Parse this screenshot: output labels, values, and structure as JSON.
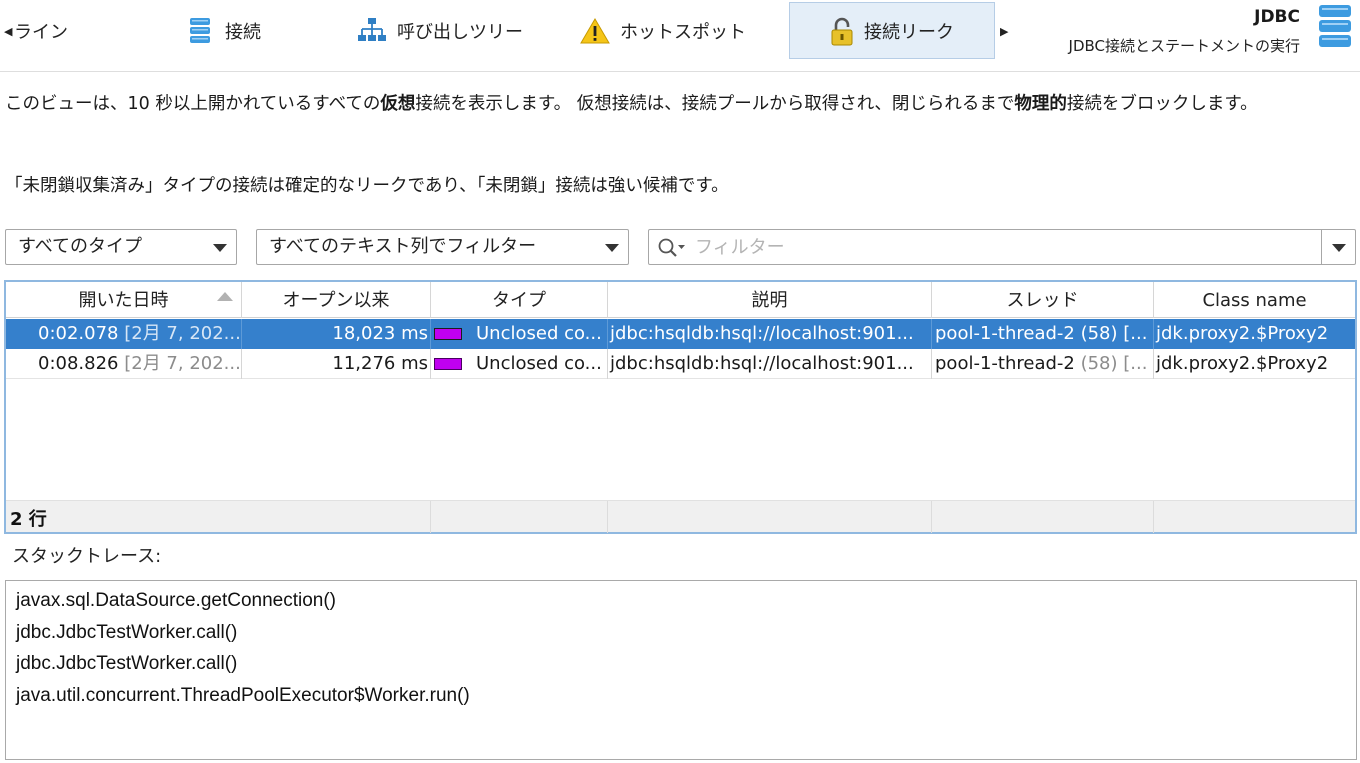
{
  "nav": {
    "tabs": [
      {
        "label": "ライン"
      },
      {
        "label": "接続"
      },
      {
        "label": "呼び出しツリー"
      },
      {
        "label": "ホットスポット"
      },
      {
        "label": "接続リーク"
      }
    ],
    "title": "JDBC",
    "subtitle": "JDBC接続とステートメントの実行"
  },
  "description": {
    "part1": "このビューは、10 秒以上開かれているすべての",
    "bold1": "仮想",
    "part2": "接続を表示します。 仮想接続は、接続プールから取得され、閉じられるまで",
    "bold2": "物理的",
    "part3": "接続をブロックします。",
    "note": "「未閉鎖収集済み」タイプの接続は確定的なリークであり、「未閉鎖」接続は強い候補です。"
  },
  "filters": {
    "type_filter": "すべてのタイプ",
    "column_filter": "すべてのテキスト列でフィルター",
    "search_placeholder": "フィルター"
  },
  "table": {
    "columns": [
      "開いた日時",
      "オープン以来",
      "タイプ",
      "説明",
      "スレッド",
      "Class name"
    ],
    "rows": [
      {
        "opened": "0:02.078",
        "opened_date": "[2月 7, 202...",
        "since": "18,023 ms",
        "type": "Unclosed co...",
        "description": "jdbc:hsqldb:hsql://localhost:901...",
        "thread": "pool-1-thread-2",
        "thread_id": "(58) [...",
        "class": "jdk.proxy2.$Proxy2"
      },
      {
        "opened": "0:08.826",
        "opened_date": "[2月 7, 202...",
        "since": "11,276 ms",
        "type": "Unclosed co...",
        "description": "jdbc:hsqldb:hsql://localhost:901...",
        "thread": "pool-1-thread-2",
        "thread_id": "(58) [...",
        "class": "jdk.proxy2.$Proxy2"
      }
    ],
    "row_count": "2 行"
  },
  "stack": {
    "label": "スタックトレース:",
    "frames": [
      "javax.sql.DataSource.getConnection()",
      "jdbc.JdbcTestWorker.call()",
      "jdbc.JdbcTestWorker.call()",
      "java.util.concurrent.ThreadPoolExecutor$Worker.run()"
    ]
  },
  "colors": {
    "selection": "#3580cc",
    "type_swatch": "#c000f0",
    "database_icon": "#3d9be0"
  }
}
